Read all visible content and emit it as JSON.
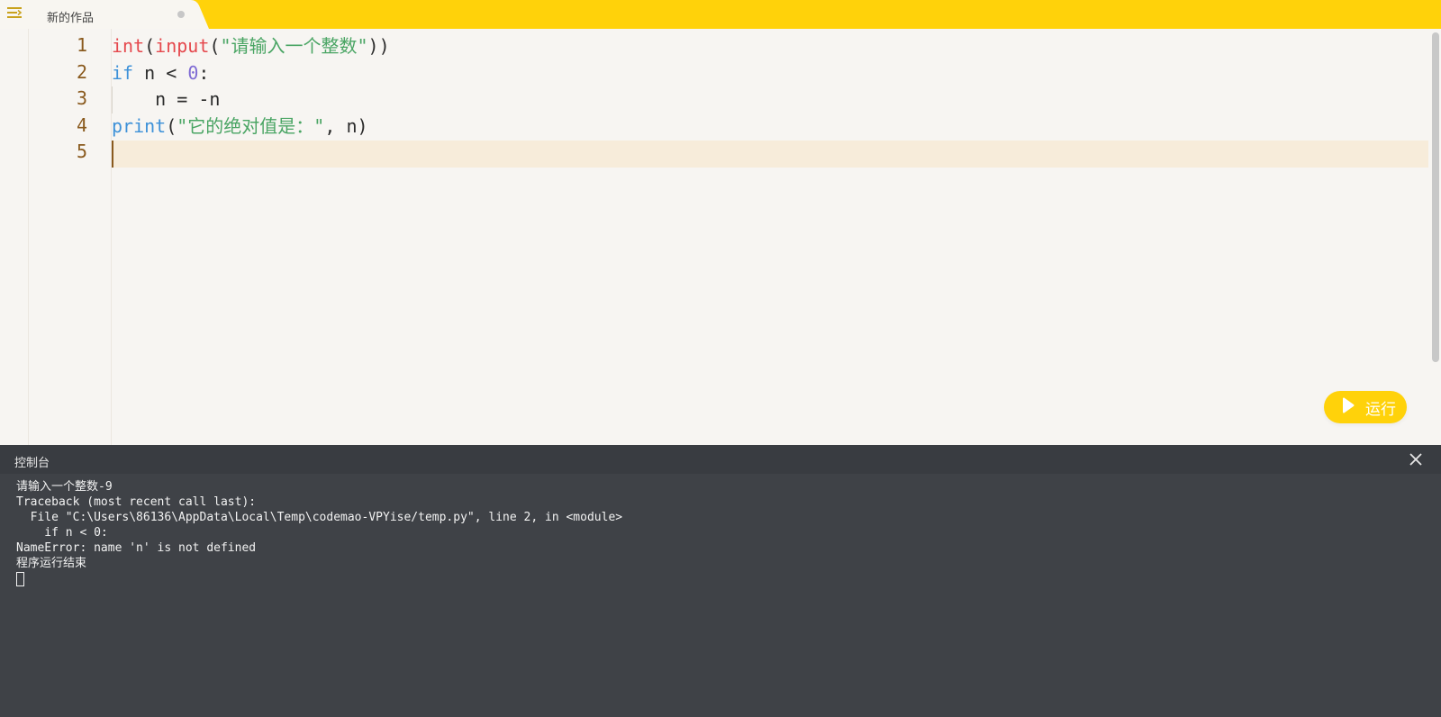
{
  "tab": {
    "title": "新的作品"
  },
  "editor": {
    "line_numbers": [
      "1",
      "2",
      "3",
      "4",
      "5"
    ],
    "lines": [
      [
        {
          "t": "int",
          "c": "fn"
        },
        {
          "t": "(",
          "c": "pl"
        },
        {
          "t": "input",
          "c": "fn"
        },
        {
          "t": "(",
          "c": "pl"
        },
        {
          "t": "\"请输入一个整数\"",
          "c": "str"
        },
        {
          "t": "))",
          "c": "pl"
        }
      ],
      [
        {
          "t": "if",
          "c": "kw"
        },
        {
          "t": " n < ",
          "c": "pl"
        },
        {
          "t": "0",
          "c": "num"
        },
        {
          "t": ":",
          "c": "pl"
        }
      ],
      [
        {
          "t": "    n = -n",
          "c": "pl"
        }
      ],
      [
        {
          "t": "print",
          "c": "kw"
        },
        {
          "t": "(",
          "c": "pl"
        },
        {
          "t": "\"它的绝对值是：\"",
          "c": "str"
        },
        {
          "t": ", n)",
          "c": "pl"
        }
      ],
      []
    ]
  },
  "run_button": {
    "label": "运行"
  },
  "console": {
    "title": "控制台",
    "lines": [
      "请输入一个整数-9",
      "Traceback (most recent call last):",
      "  File \"C:\\Users\\86136\\AppData\\Local\\Temp\\codemao-VPYise/temp.py\", line 2, in <module>",
      "    if n < 0:",
      "NameError: name 'n' is not defined",
      "程序运行结束"
    ]
  },
  "colors": {
    "accent": "#ffd20a",
    "function": "#e5484d",
    "string": "#4aa564",
    "keyword": "#3d91d8",
    "number": "#7f6bd4",
    "line_number": "#8a5a1e",
    "console_bg": "#3f4247"
  },
  "icons": {
    "menu": "menu-collapse-icon",
    "run": "play-icon",
    "close": "close-icon"
  }
}
